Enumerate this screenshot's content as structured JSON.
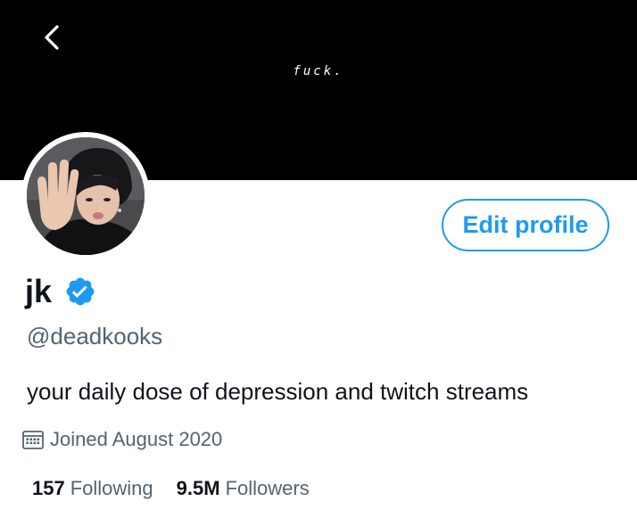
{
  "banner": {
    "text": "fuck."
  },
  "profile": {
    "display_name": "jk",
    "handle": "@deadkooks",
    "bio": "your daily dose of depression and twitch streams",
    "joined": "Joined August 2020",
    "verified": true,
    "edit_button_label": "Edit profile"
  },
  "stats": {
    "following_count": "157",
    "following_label": "Following",
    "followers_count": "9.5M",
    "followers_label": "Followers"
  },
  "colors": {
    "accent": "#1d9bf0",
    "banner": "#000000",
    "secondary_text": "#536471",
    "primary_text": "#0f1419"
  },
  "icons": {
    "back": "chevron-left-icon",
    "verified": "verified-badge-icon",
    "calendar": "calendar-icon"
  }
}
